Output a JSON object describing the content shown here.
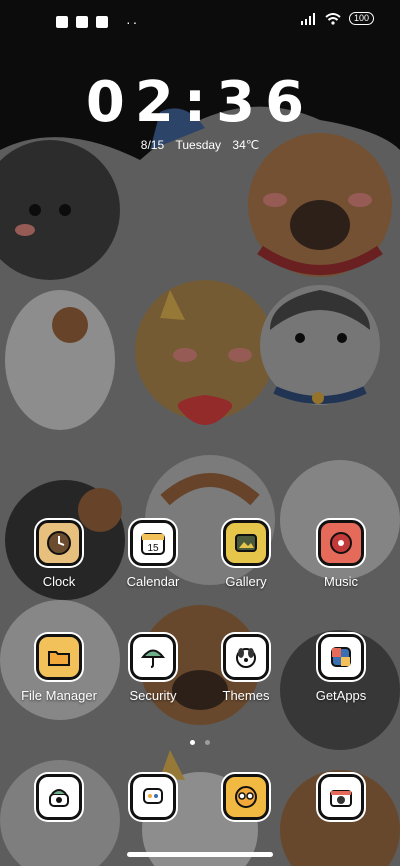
{
  "status_bar": {
    "battery": "100",
    "notification_icons": [
      "app-notification-icon",
      "gallery-notification-icon",
      "download-notification-icon"
    ],
    "more": "··"
  },
  "lockclock": {
    "time": "02:36",
    "date": "8/15",
    "weekday": "Tuesday",
    "temperature": "34℃"
  },
  "apps": [
    {
      "name": "clock",
      "label": "Clock",
      "icon": "clock-icon",
      "color": "#e8c07d"
    },
    {
      "name": "calendar",
      "label": "Calendar",
      "icon": "calendar-icon",
      "color": "#ffffff"
    },
    {
      "name": "gallery",
      "label": "Gallery",
      "icon": "gallery-icon",
      "color": "#e6c54b"
    },
    {
      "name": "music",
      "label": "Music",
      "icon": "music-icon",
      "color": "#e66a5a"
    },
    {
      "name": "file-manager",
      "label": "File Manager",
      "icon": "folder-icon",
      "color": "#f2c15a"
    },
    {
      "name": "security",
      "label": "Security",
      "icon": "umbrella-icon",
      "color": "#ffffff"
    },
    {
      "name": "themes",
      "label": "Themes",
      "icon": "dog-theme-icon",
      "color": "#ffffff"
    },
    {
      "name": "getapps",
      "label": "GetApps",
      "icon": "getapps-icon",
      "color": "#ffffff"
    }
  ],
  "dock": [
    {
      "name": "phone",
      "icon": "phone-icon",
      "color": "#ffffff"
    },
    {
      "name": "messages",
      "icon": "messages-icon",
      "color": "#ffffff"
    },
    {
      "name": "browser",
      "icon": "browser-icon",
      "color": "#f2b942"
    },
    {
      "name": "camera",
      "icon": "camera-icon",
      "color": "#ffffff"
    }
  ],
  "colors": {
    "wallpaper_bg": "#7c7c7c",
    "text": "#ffffff"
  }
}
